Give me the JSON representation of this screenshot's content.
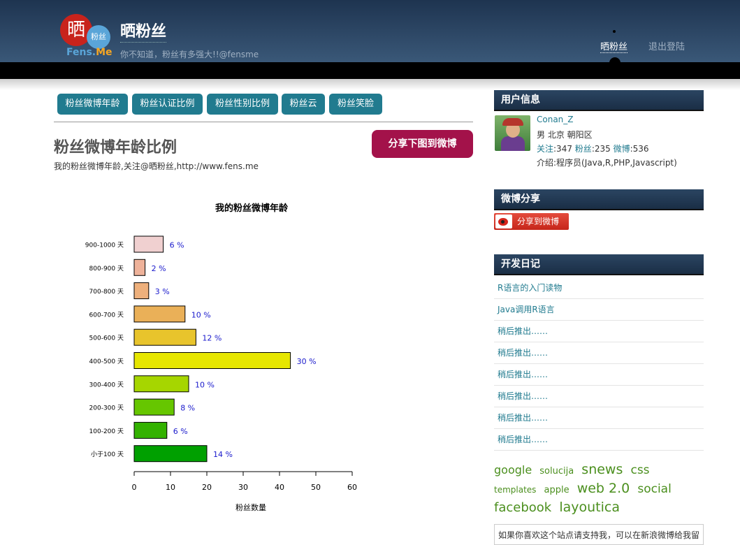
{
  "header": {
    "logo": {
      "mark": "晒",
      "badge": "粉丝",
      "wordmark_a": "Fens.",
      "wordmark_b": "Me"
    },
    "site_title": "晒粉丝",
    "site_subtitle": "你不知道，粉丝有多强大!!@fensme",
    "nav": {
      "active": "晒粉丝",
      "logout": "退出登陆"
    }
  },
  "tabs": [
    "粉丝微博年龄",
    "粉丝认证比例",
    "粉丝性别比例",
    "粉丝云",
    "粉丝笑脸"
  ],
  "page": {
    "title": "粉丝微博年龄比例",
    "subtitle": "我的粉丝微博年龄,关注@晒粉丝,http://www.fens.me",
    "share_button": "分享下图到微博"
  },
  "chart_data": {
    "type": "bar",
    "orientation": "horizontal",
    "title": "我的粉丝微博年龄",
    "xlabel": "粉丝数量",
    "ylabel": "",
    "xlim": [
      0,
      60
    ],
    "xticks": [
      0,
      10,
      20,
      30,
      40,
      50,
      60
    ],
    "categories": [
      "900-1000 天",
      "800-900 天",
      "700-800 天",
      "600-700 天",
      "500-600 天",
      "400-500 天",
      "300-400 天",
      "200-300 天",
      "100-200 天",
      "小于100 天"
    ],
    "values": [
      8,
      3,
      4,
      14,
      17,
      43,
      15,
      11,
      9,
      20
    ],
    "labels": [
      "6 %",
      "2 %",
      "3 %",
      "10 %",
      "12 %",
      "30 %",
      "10 %",
      "8 %",
      "6 %",
      "14 %"
    ],
    "colors": [
      "#f0d0d0",
      "#eeb29a",
      "#eeb07c",
      "#eab058",
      "#e8c42c",
      "#e6e600",
      "#a6d600",
      "#66c600",
      "#33b200",
      "#00a000"
    ],
    "label_color": "#1a1acc"
  },
  "sidebar": {
    "user_header": "用户信息",
    "user": {
      "name": "Conan_Z",
      "info": "男  北京 朝阳区",
      "follow_label": "关注",
      "follow_value": ":347",
      "fans_label": "粉丝",
      "fans_value": ":235",
      "weibo_label": "微博",
      "weibo_value": ":536",
      "intro": "介绍:程序员(Java,R,PHP,Javascript)"
    },
    "share_header": "微博分享",
    "share_weibo": "分享到微博",
    "diary_header": "开发日记",
    "diary": [
      "R语言的入门读物",
      "Java调用R语言",
      "稍后推出……",
      "稍后推出……",
      "稍后推出……",
      "稍后推出……",
      "稍后推出……",
      "稍后推出……"
    ],
    "tags": [
      {
        "text": "google",
        "size": 16
      },
      {
        "text": "solucija",
        "size": 13
      },
      {
        "text": "snews",
        "size": 19
      },
      {
        "text": "css",
        "size": 17
      },
      {
        "text": "templates",
        "size": 12
      },
      {
        "text": "apple",
        "size": 13
      },
      {
        "text": "web 2.0",
        "size": 19
      },
      {
        "text": "social",
        "size": 17
      },
      {
        "text": "facebook",
        "size": 18
      },
      {
        "text": "layoutica",
        "size": 19
      }
    ],
    "support_text": "如果你喜欢这个站点请支持我，可以在新浪微博给我留"
  }
}
